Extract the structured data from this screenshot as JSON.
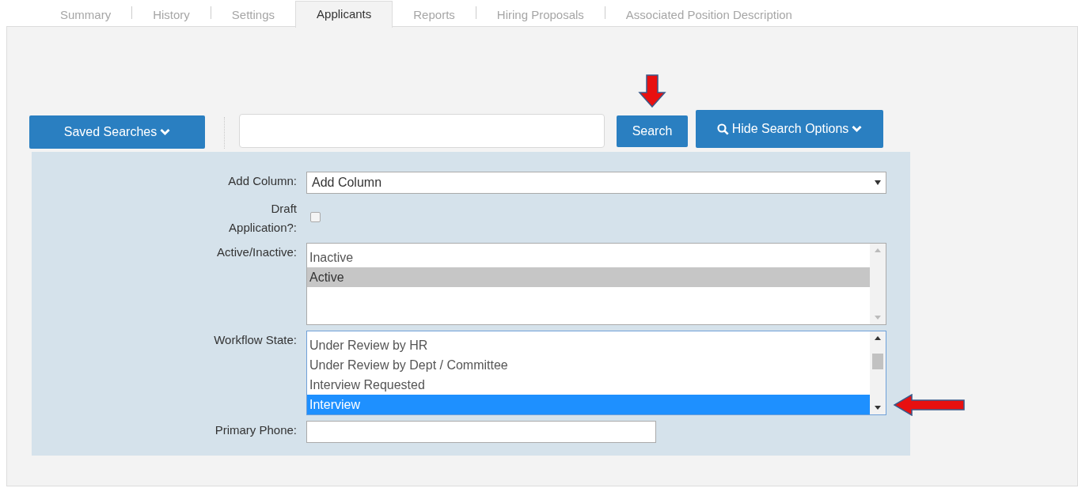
{
  "tabs": [
    {
      "label": "Summary",
      "selected": false
    },
    {
      "label": "History",
      "selected": false
    },
    {
      "label": "Settings",
      "selected": false
    },
    {
      "label": "Applicants",
      "selected": true
    },
    {
      "label": "Reports",
      "selected": false
    },
    {
      "label": "Hiring Proposals",
      "selected": false
    },
    {
      "label": "Associated Position Description",
      "selected": false
    }
  ],
  "toolbar": {
    "saved_searches": "Saved Searches",
    "search_button": "Search",
    "hide_options": "Hide Search Options"
  },
  "form": {
    "add_column": {
      "label": "Add Column:",
      "value": "Add Column"
    },
    "draft": {
      "label": "Draft Application?:",
      "checked": false
    },
    "active": {
      "label": "Active/Inactive:",
      "focused": false,
      "options": [
        {
          "label": "Inactive",
          "selected": false
        },
        {
          "label": "Active",
          "selected": true
        }
      ]
    },
    "workflow": {
      "label": "Workflow State:",
      "focused": true,
      "options": [
        {
          "label": "Under Review by HR",
          "selected": false
        },
        {
          "label": "Under Review by Dept / Committee",
          "selected": false
        },
        {
          "label": "Interview Requested",
          "selected": false
        },
        {
          "label": "Interview",
          "selected": true
        }
      ]
    },
    "phone": {
      "label": "Primary Phone:"
    }
  }
}
